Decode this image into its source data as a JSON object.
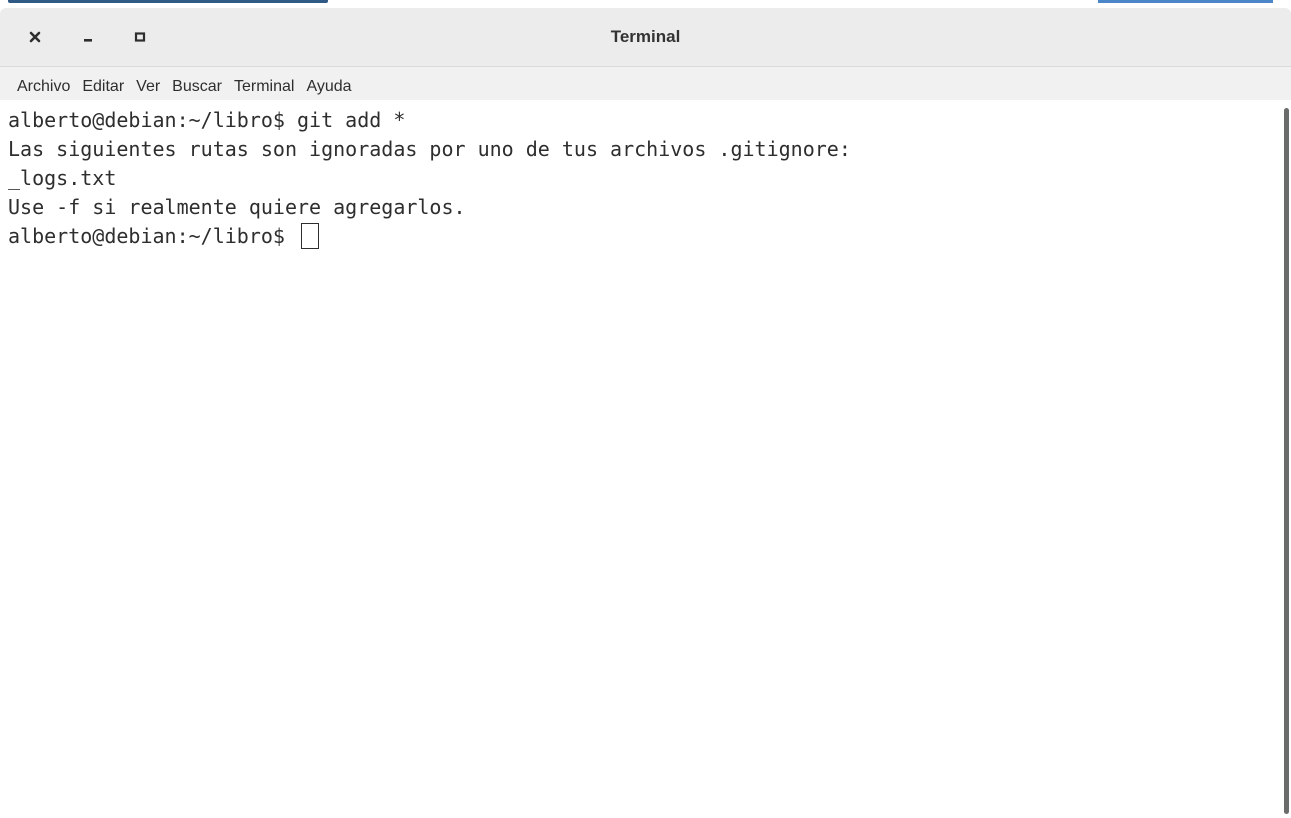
{
  "window": {
    "title": "Terminal",
    "controls": {
      "close_icon": "close-icon",
      "minimize_icon": "minimize-icon",
      "maximize_icon": "maximize-icon"
    }
  },
  "menubar": {
    "items": [
      "Archivo",
      "Editar",
      "Ver",
      "Buscar",
      "Terminal",
      "Ayuda"
    ]
  },
  "terminal": {
    "prompt": "alberto@debian:~/libro$ ",
    "lines": [
      "alberto@debian:~/libro$ git add *",
      "Las siguientes rutas son ignoradas por uno de tus archivos .gitignore:",
      "_logs.txt",
      "Use -f si realmente quiere agregarlos."
    ],
    "colors": {
      "text": "#2e2e2e",
      "background": "#ffffff"
    }
  }
}
